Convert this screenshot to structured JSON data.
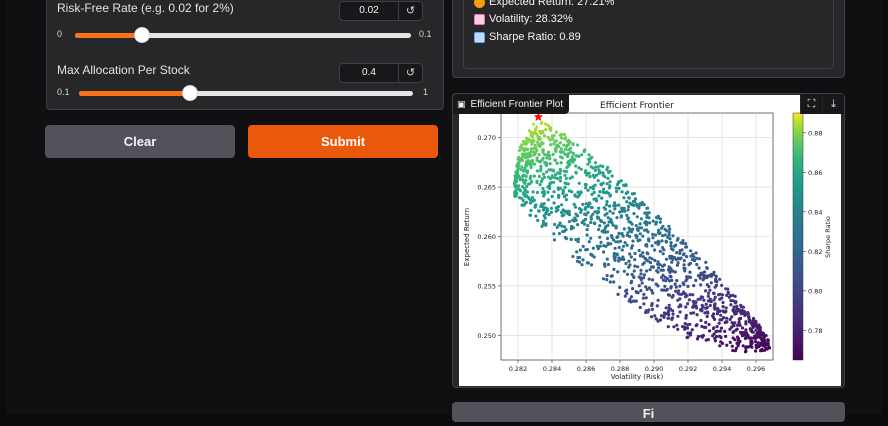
{
  "sliders": [
    {
      "label": "Risk-Free Rate (e.g. 0.02 for 2%)",
      "value": "0.02",
      "min": "0",
      "max": "0.1",
      "fraction": 0.2
    },
    {
      "label": "Max Allocation Per Stock",
      "value": "0.4",
      "min": "0.1",
      "max": "1",
      "fraction": 0.333
    }
  ],
  "reset_glyph": "↺",
  "buttons": {
    "clear": "Clear",
    "submit": "Submit",
    "bottom": "Fi"
  },
  "metrics": {
    "expected_return": "Expected Return: 27.21%",
    "volatility": "Volatility: 28.32%",
    "sharpe": "Sharpe Ratio: 0.89"
  },
  "plot": {
    "label": "Efficient Frontier Plot",
    "icons": [
      "image-icon",
      "fullscreen-icon",
      "download-icon"
    ],
    "fullscreen_glyph": "⛶",
    "download_glyph": "⤓",
    "image_glyph": "▣"
  },
  "chart_data": {
    "type": "scatter",
    "title": "Efficient Frontier",
    "xlabel": "Volatility (Risk)",
    "ylabel": "Expected Return",
    "colorbar_label": "Sharpe Ratio",
    "xlim": [
      0.281,
      0.297
    ],
    "ylim": [
      0.2475,
      0.2725
    ],
    "x_ticks": [
      "0.282",
      "0.284",
      "0.286",
      "0.288",
      "0.290",
      "0.292",
      "0.294",
      "0.296"
    ],
    "y_ticks": [
      "0.250",
      "0.255",
      "0.260",
      "0.265",
      "0.270"
    ],
    "colorbar_ticks": [
      "0.78",
      "0.80",
      "0.82",
      "0.84",
      "0.86",
      "0.88"
    ],
    "colorbar_range": [
      0.765,
      0.89
    ],
    "colormap": "viridis",
    "grid": true,
    "max_sharpe_point": {
      "x": 0.2832,
      "y": 0.2721,
      "color": "#ff0000",
      "marker": "star"
    },
    "point_cloud": {
      "description_hidden": true,
      "frontier_upper": [
        [
          0.2818,
          0.2665
        ],
        [
          0.2822,
          0.2695
        ],
        [
          0.283,
          0.2718
        ],
        [
          0.284,
          0.2712
        ],
        [
          0.2855,
          0.2695
        ],
        [
          0.287,
          0.2675
        ],
        [
          0.2885,
          0.265
        ],
        [
          0.29,
          0.2625
        ],
        [
          0.2915,
          0.26
        ],
        [
          0.293,
          0.2575
        ],
        [
          0.2945,
          0.2545
        ],
        [
          0.296,
          0.2515
        ],
        [
          0.2968,
          0.2495
        ]
      ],
      "frontier_lower": [
        [
          0.2818,
          0.264
        ],
        [
          0.283,
          0.2615
        ],
        [
          0.2845,
          0.259
        ],
        [
          0.286,
          0.2565
        ],
        [
          0.2875,
          0.2545
        ],
        [
          0.289,
          0.2528
        ],
        [
          0.2905,
          0.251
        ],
        [
          0.292,
          0.2497
        ],
        [
          0.2935,
          0.2488
        ],
        [
          0.295,
          0.2482
        ],
        [
          0.2968,
          0.2485
        ]
      ]
    }
  },
  "colors": {
    "accent": "#ea580c",
    "slider_fill": "#f97316",
    "return_icon": "#f59e0b",
    "volatility_icon": "#f472b6",
    "sharpe_icon": "#60a5fa"
  }
}
